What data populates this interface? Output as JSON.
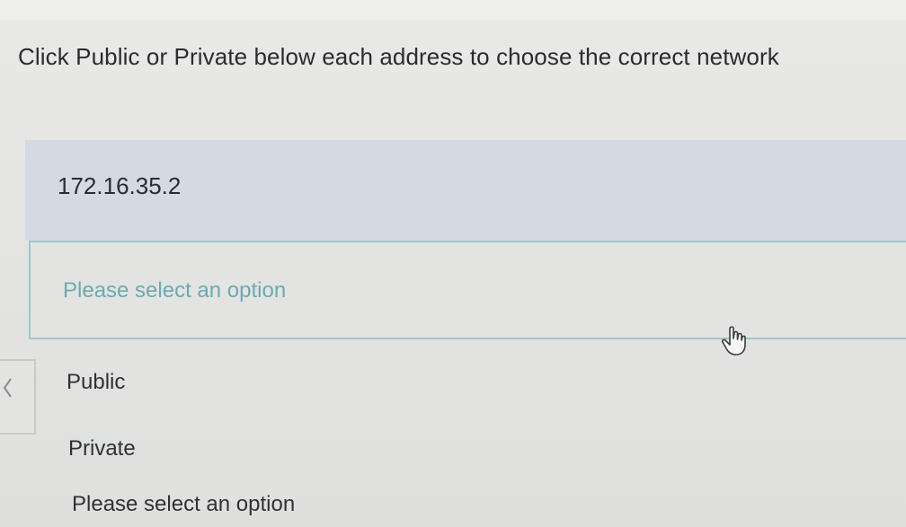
{
  "instruction": "Click Public or Private below each address to choose the correct network",
  "question": {
    "address": "172.16.35.2",
    "select_placeholder": "Please select an option"
  },
  "dropdown_options": [
    {
      "label": "Public"
    },
    {
      "label": "Private"
    },
    {
      "label": "Please select an option"
    }
  ],
  "colors": {
    "panel": "#d3dae3",
    "accent_border": "#9fc6cc",
    "placeholder_text": "#6aaab3"
  },
  "icons": {
    "cursor": "hand-pointer-icon",
    "tab": "chevron-left-icon"
  }
}
